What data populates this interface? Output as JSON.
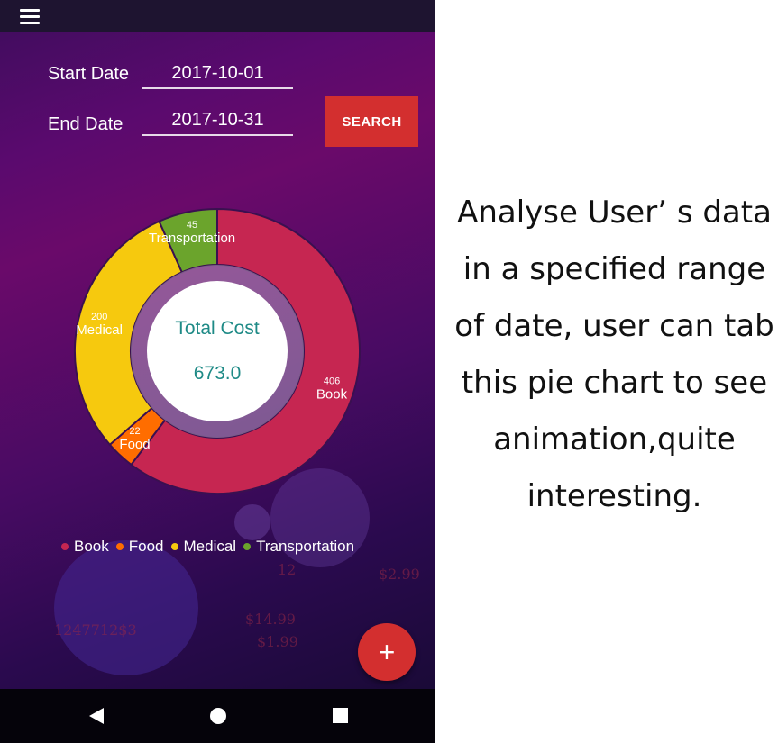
{
  "start_date": {
    "label": "Start Date",
    "value": "2017-10-01"
  },
  "end_date": {
    "label": "End Date",
    "value": "2017-10-31"
  },
  "search_button": {
    "label": "SEARCH"
  },
  "center": {
    "title": "Total Cost",
    "value": "673.0"
  },
  "fab": {
    "label": "+"
  },
  "description": "Analyse User’ s data in a specified range of date, user can tab this pie chart to see animation,quite interesting.",
  "background_text": [
    "$14.99",
    "$1.99",
    "1247712$3",
    "12",
    "$2.99"
  ],
  "colors": {
    "book": "#c62651",
    "food": "#ff6d00",
    "medical": "#f6c90e",
    "transportation": "#6ba42c",
    "accent": "#d32f2f"
  },
  "icons": {
    "menu": "menu-icon",
    "back": "back-icon",
    "home": "home-icon",
    "recents": "recents-icon"
  },
  "chart_data": {
    "type": "pie",
    "categories": [
      "Book",
      "Food",
      "Medical",
      "Transportation"
    ],
    "values": [
      406,
      22,
      200,
      45
    ],
    "total": 673.0,
    "legend_position": "bottom-left"
  }
}
